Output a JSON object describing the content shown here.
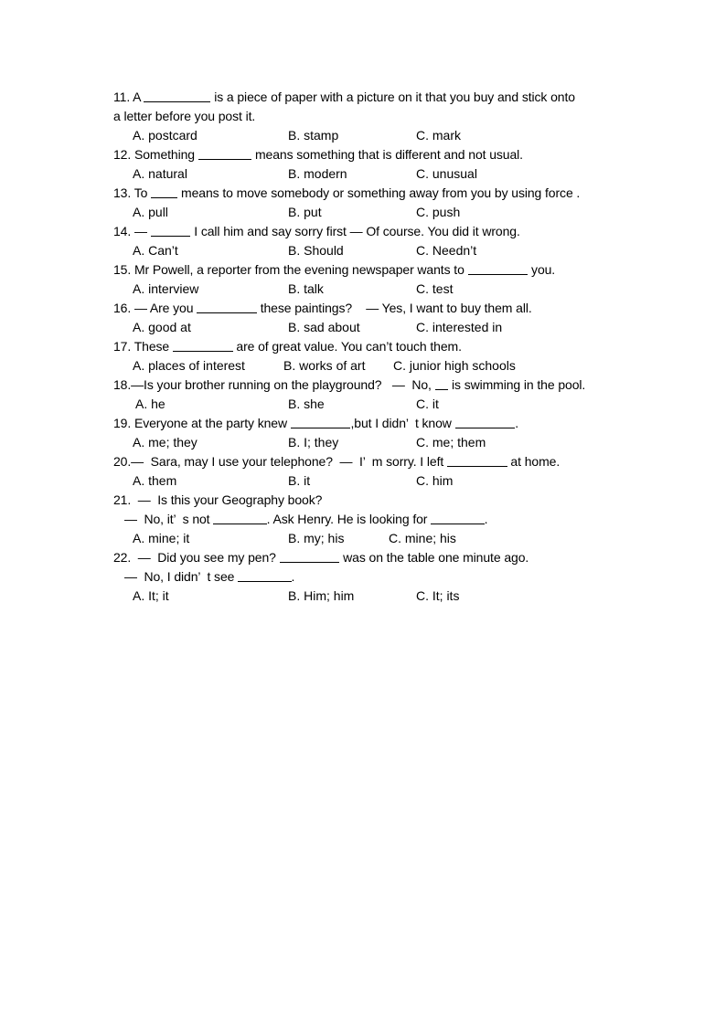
{
  "document": {
    "type": "worksheet",
    "page_background": "#ffffff",
    "text_color": "#000000"
  },
  "questions": [
    {
      "number": "11.",
      "lines": [
        "11. A __________ is a piece of paper with a picture on it that you buy and stick onto",
        "a letter before you post it."
      ],
      "line_indents": [
        0,
        0
      ],
      "options": [
        "A. postcard",
        "B. stamp",
        "C. mark"
      ],
      "option_x": [
        21,
        191,
        331
      ]
    },
    {
      "number": "12.",
      "lines": [
        "12. Something ________ means something that is different and not usual."
      ],
      "line_indents": [
        0
      ],
      "options": [
        "A. natural",
        "B. modern",
        "C. unusual"
      ],
      "option_x": [
        21,
        191,
        331
      ]
    },
    {
      "number": "13.",
      "lines": [
        "13. To ____ means to move somebody or something away from you by using force ."
      ],
      "line_indents": [
        0
      ],
      "options": [
        "A. pull",
        "B. put",
        "C. push"
      ],
      "option_x": [
        21,
        191,
        331
      ]
    },
    {
      "number": "14.",
      "lines": [
        "14. — ______ I call him and say sorry first — Of course. You did it wrong."
      ],
      "line_indents": [
        0
      ],
      "options": [
        "A. Can’t",
        "B. Should",
        "C. Needn’t"
      ],
      "option_x": [
        21,
        191,
        331
      ]
    },
    {
      "number": "15.",
      "lines": [
        "15. Mr Powell, a reporter from the evening newspaper wants to _________ you."
      ],
      "line_indents": [
        0
      ],
      "options": [
        "A. interview",
        "B. talk",
        "C. test"
      ],
      "option_x": [
        21,
        191,
        331
      ]
    },
    {
      "number": "16.",
      "lines": [
        "16. — Are you _________ these paintings?    — Yes, I want to buy them all."
      ],
      "line_indents": [
        0
      ],
      "options": [
        "A. good at",
        "B. sad about",
        "C. interested in"
      ],
      "option_x": [
        21,
        191,
        331
      ]
    },
    {
      "number": "17.",
      "lines": [
        "17. These _________ are of great value. You can’t touch them."
      ],
      "line_indents": [
        0
      ],
      "options": [
        "A. places of interest",
        "B. works of art",
        "C. junior high schools"
      ],
      "option_x": [
        21,
        186,
        306
      ]
    },
    {
      "number": "18.",
      "lines": [
        "18.—Is your brother running on the playground?   —  No, __ is swimming in the pool."
      ],
      "line_indents": [
        0
      ],
      "options": [
        "A. he",
        "B. she",
        "C. it"
      ],
      "option_x": [
        24,
        191,
        331
      ]
    },
    {
      "number": "19.",
      "lines": [
        "19. Everyone at the party knew _________,but I didn’  t know _________."
      ],
      "line_indents": [
        0
      ],
      "options": [
        "A. me; they",
        "B. I; they",
        "C. me; them"
      ],
      "option_x": [
        21,
        191,
        331
      ]
    },
    {
      "number": "20.",
      "lines": [
        "20.—  Sara, may I use your telephone?  —  I’  m sorry. I left _________ at home."
      ],
      "line_indents": [
        0
      ],
      "options": [
        "A. them",
        "B. it",
        "C. him"
      ],
      "option_x": [
        21,
        191,
        331
      ]
    },
    {
      "number": "21.",
      "lines": [
        "21.  —  Is this your Geography book?",
        "—  No, it’  s not ________. Ask Henry. He is looking for ________."
      ],
      "line_indents": [
        0,
        12
      ],
      "options": [
        "A. mine; it",
        "B. my; his",
        "C. mine; his"
      ],
      "option_x": [
        21,
        191,
        301
      ]
    },
    {
      "number": "22.",
      "lines": [
        "22.  —  Did you see my pen? _________ was on the table one minute ago.",
        "—  No, I didn’  t see ________."
      ],
      "line_indents": [
        0,
        12
      ],
      "options": [
        "A. It; it",
        "B. Him; him",
        "C. It; its"
      ],
      "option_x": [
        21,
        191,
        331
      ]
    }
  ]
}
